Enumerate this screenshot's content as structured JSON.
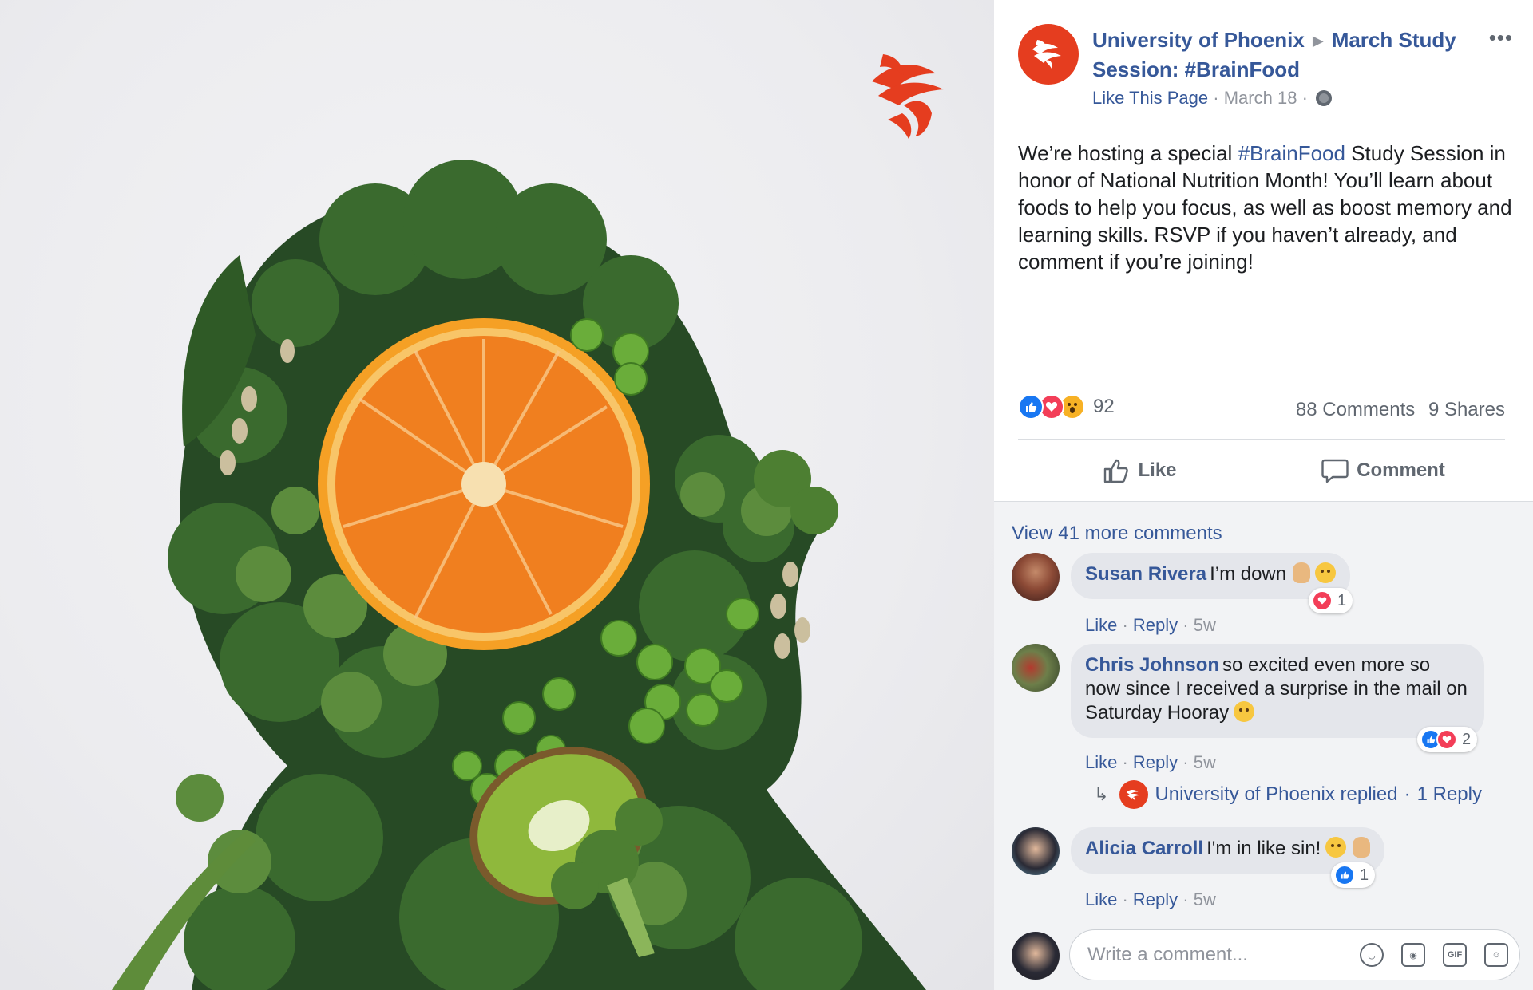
{
  "post": {
    "page_name": "University of Phoenix",
    "event_name": "March Study Session: #BrainFood",
    "like_page": "Like This Page",
    "date": "March 18",
    "text_before": "We’re hosting a special ",
    "hashtag": "#BrainFood",
    "text_after": " Study Session in honor of National Nutrition Month! You’ll learn about foods to help you focus, as well as boost memory and learning skills. RSVP if you haven’t already, and comment if you’re joining!",
    "reaction_count": "92",
    "comments_count": "88 Comments",
    "shares_count": "9 Shares",
    "like_label": "Like",
    "comment_label": "Comment"
  },
  "colors": {
    "brand": "#e53d1f",
    "link": "#365899",
    "like_blue": "#1877f2",
    "love_red": "#f33e58"
  },
  "comments": {
    "view_more": "View 41 more comments",
    "items": [
      {
        "name": "Susan Rivera",
        "text": "I’m down",
        "reaction_count": "1",
        "like": "Like",
        "reply": "Reply",
        "age": "5w"
      },
      {
        "name": "Chris Johnson",
        "text": "so excited even more so now since I received a surprise in the mail on Saturday Hooray",
        "reaction_count": "2",
        "like": "Like",
        "reply": "Reply",
        "age": "5w"
      },
      {
        "name": "Alicia Carroll",
        "text": "I'm in like sin!",
        "reaction_count": "1",
        "like": "Like",
        "reply": "Reply",
        "age": "5w"
      }
    ],
    "reply_summary": "University of Phoenix replied",
    "reply_count": "1 Reply"
  },
  "compose": {
    "placeholder": "Write a comment..."
  },
  "icons": [
    "phoenix-logo-icon",
    "globe-icon",
    "more-icon",
    "like-icon",
    "love-icon",
    "wow-icon",
    "thumbs-up-icon",
    "comment-icon",
    "reply-arrow-icon",
    "emoji-icon",
    "camera-icon",
    "gif-icon",
    "sticker-icon"
  ]
}
